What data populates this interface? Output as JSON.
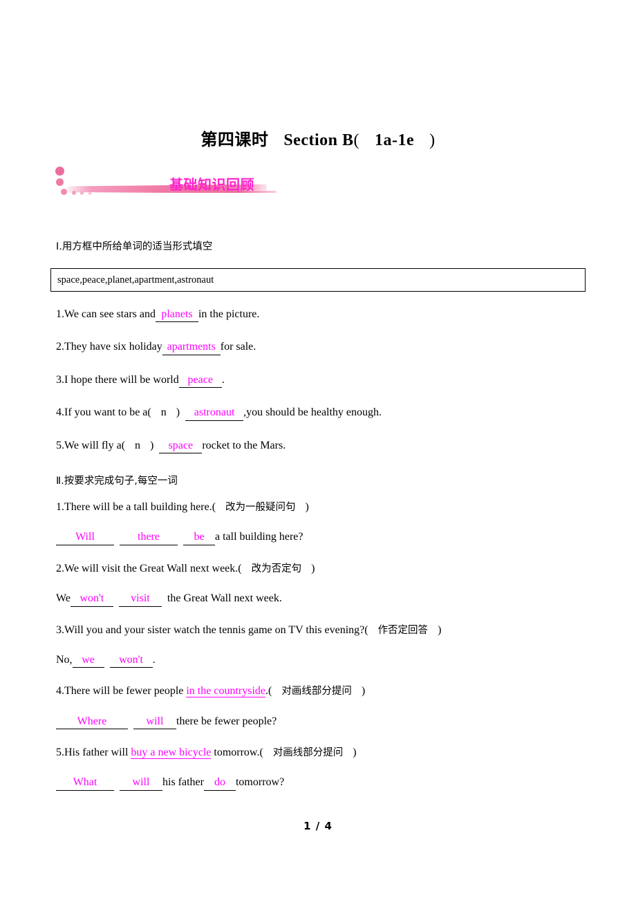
{
  "title": {
    "lesson": "第四课时",
    "section": "Section B",
    "paren_open": "(",
    "range": "1a-1e",
    "paren_close": ")"
  },
  "banner": {
    "label": "基础知识回顾",
    "accent_color": "#ff22cc",
    "ribbon_color": "#ee6e9e"
  },
  "section_one": {
    "heading": "Ⅰ.用方框中所给单词的适当形式填空",
    "wordbox": "space,peace,planet,apartment,astronaut",
    "items": [
      {
        "num": "1.",
        "pre": "We can see stars and",
        "answer": "planets",
        "post": "in the picture."
      },
      {
        "num": "2.",
        "pre": "They have six holiday",
        "answer": "apartments",
        "post": "for sale."
      },
      {
        "num": "3.",
        "pre": "I hope there will be world",
        "answer": "peace",
        "post": "."
      },
      {
        "num": "4.",
        "pre": "If you want to be a(",
        "mid": "n",
        "pre2": ")",
        "answer": "astronaut",
        "post": ",you should be healthy enough."
      },
      {
        "num": "5.",
        "pre": "We will fly a(",
        "mid": "n",
        "pre2": ")",
        "answer": "space",
        "post": "rocket to the Mars."
      }
    ]
  },
  "section_two": {
    "heading": "Ⅱ.按要求完成句子,每空一词",
    "items": [
      {
        "num": "1.",
        "prompt": "There will be a tall building here.(",
        "instruction": "改为一般疑问句",
        "prompt_close": ")",
        "answer_pre": "",
        "blanks": [
          "Will",
          "there",
          "be"
        ],
        "answer_post": "a tall building here?"
      },
      {
        "num": "2.",
        "prompt": "We will visit the Great Wall next week.(",
        "instruction": "改为否定句",
        "prompt_close": ")",
        "answer_pre": "We",
        "blanks": [
          "won't",
          "visit"
        ],
        "answer_post": "the Great Wall next week."
      },
      {
        "num": "3.",
        "prompt": "Will you and your sister watch the tennis game on TV this evening?(",
        "instruction": "作否定回答",
        "prompt_close": ")",
        "answer_pre": "No,",
        "blanks": [
          "we",
          "won't"
        ],
        "answer_post": "."
      },
      {
        "num": "4.",
        "prompt_a": "There will be fewer people ",
        "underlined": "in the countryside",
        "prompt_b": ".(",
        "instruction": "对画线部分提问",
        "prompt_close": ")",
        "answer_pre": "",
        "blanks": [
          "Where",
          "will"
        ],
        "answer_post": "there be fewer people?"
      },
      {
        "num": "5.",
        "prompt_a": "His father will ",
        "underlined": "buy a new bicycle",
        "prompt_b": " tomorrow.(",
        "instruction": "对画线部分提问",
        "prompt_close": ")",
        "answer_pre": "",
        "blanks": [
          "What",
          "will"
        ],
        "answer_mid": "his father",
        "blanks2": [
          "do"
        ],
        "answer_post": "tomorrow?"
      }
    ]
  },
  "footer": {
    "page_label": "1 / 4"
  }
}
